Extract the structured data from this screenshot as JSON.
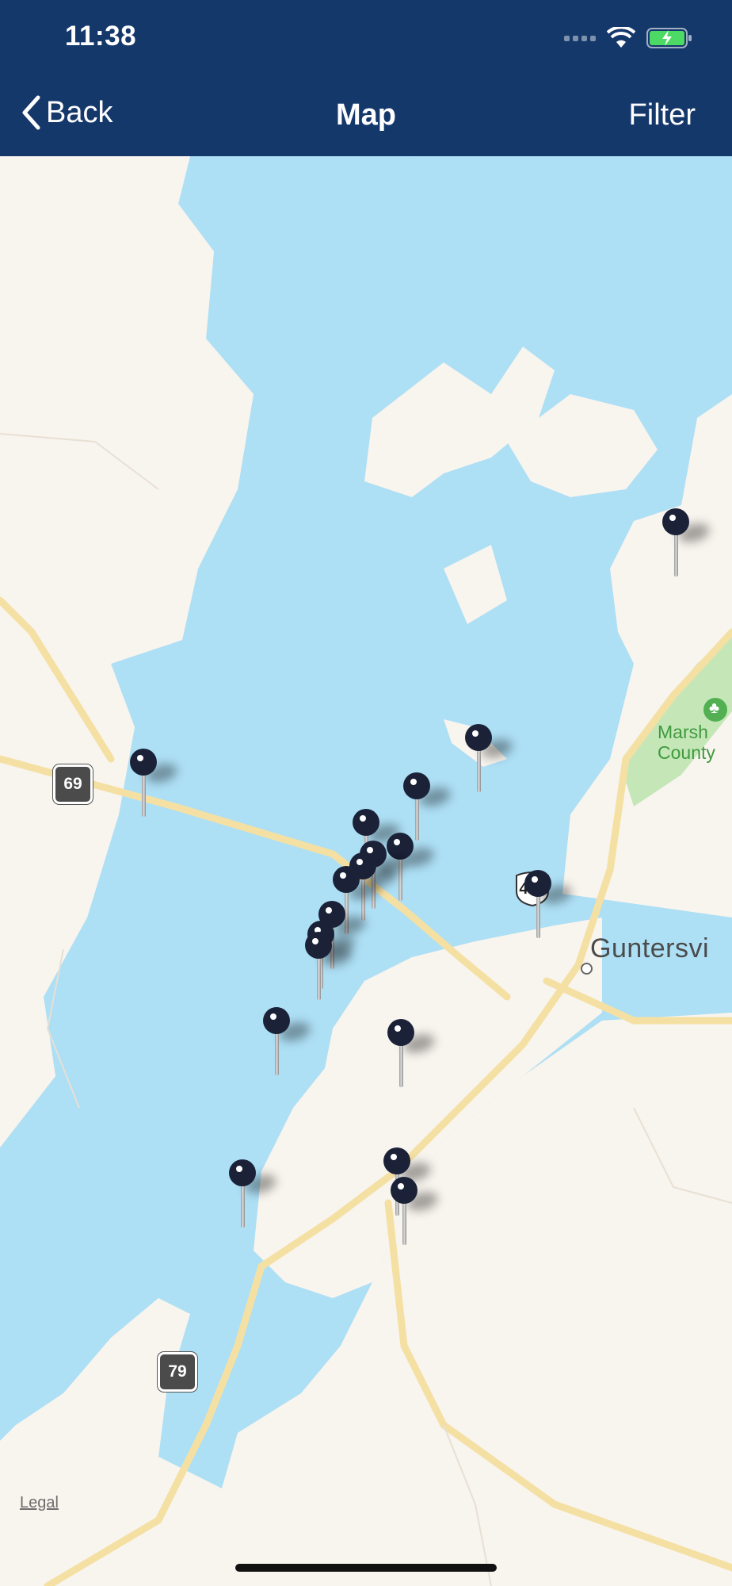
{
  "status_bar": {
    "time": "11:38"
  },
  "nav": {
    "back_label": "Back",
    "title": "Map",
    "filter_label": "Filter"
  },
  "map": {
    "city_label": "Guntersvi",
    "park_label_line1": "Marsh",
    "park_label_line2": "County",
    "route_69": "69",
    "route_79": "79",
    "route_431": "431",
    "legal": "Legal"
  },
  "colors": {
    "header": "#15386b",
    "water": "#addff5",
    "land": "#f8f4ee",
    "road": "#f5e0a3",
    "park": "#c5e7b8",
    "pin": "#1b2238"
  }
}
